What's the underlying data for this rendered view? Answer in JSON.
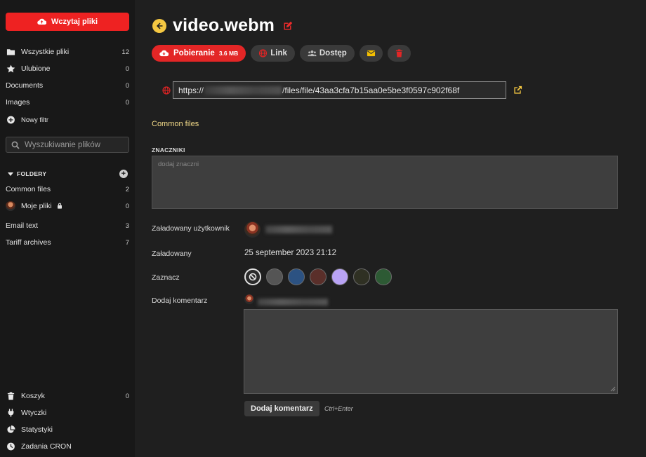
{
  "sidebar": {
    "upload_label": "Wczytaj pliki",
    "nav": [
      {
        "label": "Wszystkie pliki",
        "count": "12",
        "icon": "folder-icon"
      },
      {
        "label": "Ulubione",
        "count": "0",
        "icon": "star-icon"
      },
      {
        "label": "Documents",
        "count": "0",
        "icon": ""
      },
      {
        "label": "Images",
        "count": "0",
        "icon": ""
      },
      {
        "label": "Nowy filtr",
        "count": "",
        "icon": "plus-circle-icon"
      }
    ],
    "search_placeholder": "Wyszukiwanie plików",
    "folders_heading": "FOLDERY",
    "folders": [
      {
        "label": "Common files",
        "count": "2"
      },
      {
        "label": "Moje pliki",
        "count": "0",
        "locked": true
      },
      {
        "label": "Email text",
        "count": "3"
      },
      {
        "label": "Tariff archives",
        "count": "7"
      }
    ],
    "bottom": [
      {
        "label": "Koszyk",
        "count": "0",
        "icon": "trash-icon"
      },
      {
        "label": "Wtyczki",
        "count": "",
        "icon": "plug-icon"
      },
      {
        "label": "Statystyki",
        "count": "",
        "icon": "pie-chart-icon"
      },
      {
        "label": "Zadania CRON",
        "count": "",
        "icon": "clock-icon"
      }
    ]
  },
  "file": {
    "title": "video.webm",
    "download_label": "Pobieranie",
    "download_size": "3.6 MB",
    "link_label": "Link",
    "access_label": "Dostęp",
    "url_prefix": "https://",
    "url_suffix": "/files/file/43aa3cfa7b15aa0e5be3f0597c902f68f",
    "folder": "Common files",
    "tags_heading": "ZNACZNIKI",
    "tags_placeholder": "dodaj znaczni",
    "uploaded_by_label": "Załadowany użytkownik",
    "uploaded_label": "Załadowany",
    "uploaded_date": "25 september 2023 21:12",
    "mark_label": "Zaznacz",
    "comment_label": "Dodaj komentarz",
    "submit_label": "Dodaj komentarz",
    "shortcut": "Ctrl+Enter"
  },
  "colors": {
    "accent_red": "#e32626",
    "back_yellow": "#f5c842",
    "folder_link": "#f5dc8a",
    "swatches": [
      "#555555",
      "#2c5282",
      "#5a2f2a",
      "#b9a3f5",
      "#2f3023",
      "#2d5a34"
    ]
  }
}
